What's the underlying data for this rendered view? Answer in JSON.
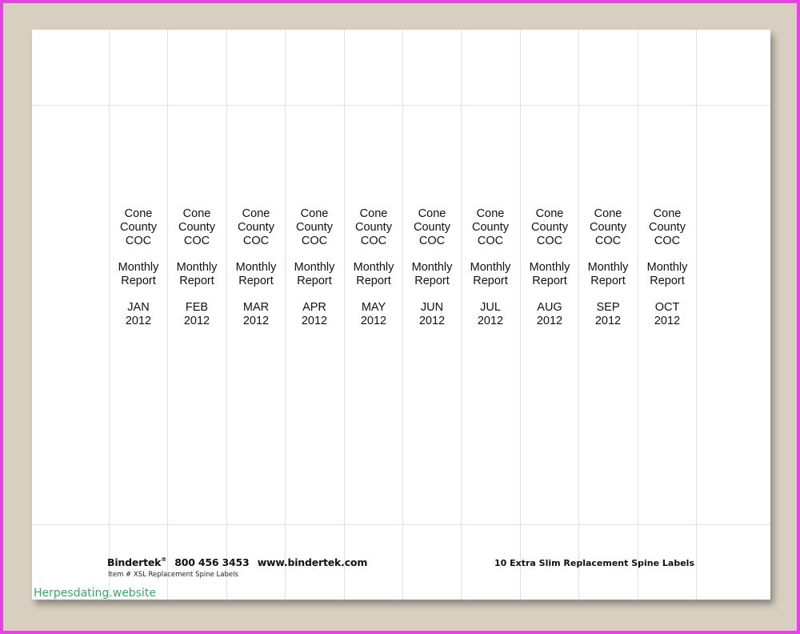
{
  "labels": [
    {
      "org_1": "Cone",
      "org_2": "County",
      "org_3": "COC",
      "title_1": "Monthly",
      "title_2": "Report",
      "month": "JAN",
      "year": "2012"
    },
    {
      "org_1": "Cone",
      "org_2": "County",
      "org_3": "COC",
      "title_1": "Monthly",
      "title_2": "Report",
      "month": "FEB",
      "year": "2012"
    },
    {
      "org_1": "Cone",
      "org_2": "County",
      "org_3": "COC",
      "title_1": "Monthly",
      "title_2": "Report",
      "month": "MAR",
      "year": "2012"
    },
    {
      "org_1": "Cone",
      "org_2": "County",
      "org_3": "COC",
      "title_1": "Monthly",
      "title_2": "Report",
      "month": "APR",
      "year": "2012"
    },
    {
      "org_1": "Cone",
      "org_2": "County",
      "org_3": "COC",
      "title_1": "Monthly",
      "title_2": "Report",
      "month": "MAY",
      "year": "2012"
    },
    {
      "org_1": "Cone",
      "org_2": "County",
      "org_3": "COC",
      "title_1": "Monthly",
      "title_2": "Report",
      "month": "JUN",
      "year": "2012"
    },
    {
      "org_1": "Cone",
      "org_2": "County",
      "org_3": "COC",
      "title_1": "Monthly",
      "title_2": "Report",
      "month": "JUL",
      "year": "2012"
    },
    {
      "org_1": "Cone",
      "org_2": "County",
      "org_3": "COC",
      "title_1": "Monthly",
      "title_2": "Report",
      "month": "AUG",
      "year": "2012"
    },
    {
      "org_1": "Cone",
      "org_2": "County",
      "org_3": "COC",
      "title_1": "Monthly",
      "title_2": "Report",
      "month": "SEP",
      "year": "2012"
    },
    {
      "org_1": "Cone",
      "org_2": "County",
      "org_3": "COC",
      "title_1": "Monthly",
      "title_2": "Report",
      "month": "OCT",
      "year": "2012"
    }
  ],
  "footer": {
    "brand": "Bindertek",
    "registered_mark": "®",
    "phone": "800 456 3453",
    "website": "www.bindertek.com",
    "item_line": "Item # XSL Replacement Spine Labels",
    "product_count": "10 Extra Slim Replacement Spine Labels"
  },
  "watermark": "Herpesdating.website",
  "colors": {
    "frame": "#e640e6",
    "backdrop": "#d8cfc0",
    "sheet": "#ffffff",
    "watermark": "#3ca66a"
  }
}
